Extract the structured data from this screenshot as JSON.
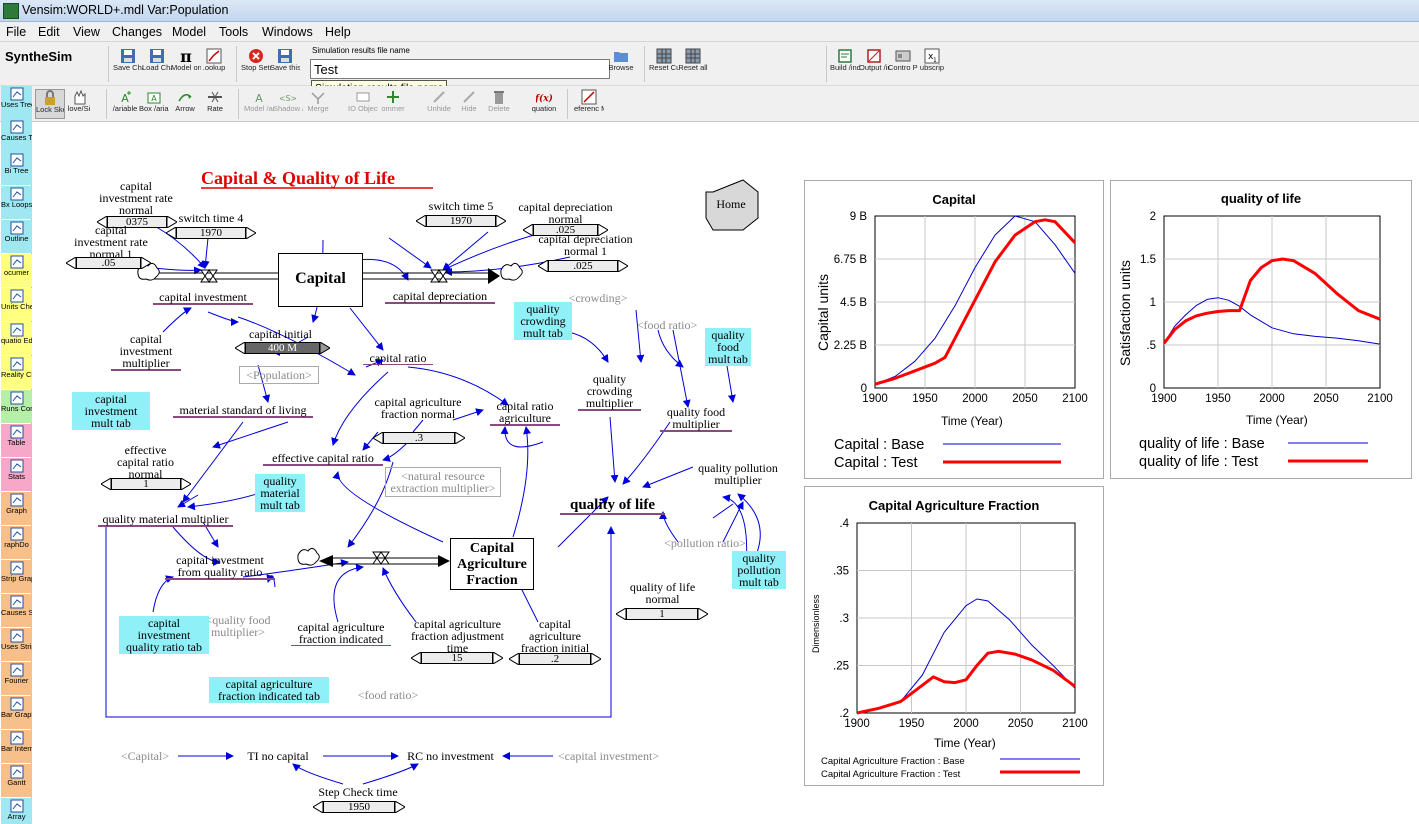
{
  "window": {
    "title": "Vensim:WORLD+.mdl Var:Population"
  },
  "menu": [
    "File",
    "Edit",
    "View",
    "Changes",
    "Model",
    "Tools",
    "Windows",
    "Help"
  ],
  "toolbar1": {
    "synthesim": "SyntheSim",
    "results_label": "Simulation results file name",
    "results_value": "Test",
    "tooltip": "Simulation results file name",
    "buttons": [
      {
        "label": "Save Change"
      },
      {
        "label": "Load Change"
      },
      {
        "label": "Model onstan"
      },
      {
        "label": ".ookup"
      },
      {
        "label": "Stop Setup"
      },
      {
        "label": "Save this"
      },
      {
        "label": "Browse"
      },
      {
        "label": "Reset Current"
      },
      {
        "label": "Reset all"
      },
      {
        "label": "Build /indow"
      },
      {
        "label": "Output /indow"
      },
      {
        "label": "Contro Panel"
      },
      {
        "label": "ubscrip"
      }
    ]
  },
  "toolbar2": {
    "buttons": [
      {
        "label": "Lock Sketch"
      },
      {
        "label": "love/Si"
      },
      {
        "label": "/ariable"
      },
      {
        "label": "Box /ariabl"
      },
      {
        "label": "Arrow"
      },
      {
        "label": "Rate"
      },
      {
        "label": "Model /ariabl"
      },
      {
        "label": "Shadow /ariabl"
      },
      {
        "label": "Merge"
      },
      {
        "label": "IO Object"
      },
      {
        "label": "ommer"
      },
      {
        "label": "Unhide"
      },
      {
        "label": "Hide"
      },
      {
        "label": "Delete"
      },
      {
        "label": "quation"
      },
      {
        "label": "eferenc Mode"
      }
    ]
  },
  "palette": [
    {
      "label": "Uses Tree",
      "color": "#9fe8f2"
    },
    {
      "label": "Causes Tree",
      "color": "#9fe8f2"
    },
    {
      "label": "Bi Tree",
      "color": "#9fe8f2"
    },
    {
      "label": "Bx Loops",
      "color": "#9fe8f2"
    },
    {
      "label": "Outline",
      "color": "#9fe8f2"
    },
    {
      "label": "ocumer",
      "color": "#ffff80"
    },
    {
      "label": "Units Check",
      "color": "#ffff80"
    },
    {
      "label": "quatio Editor",
      "color": "#ffff80"
    },
    {
      "label": "Reality Check",
      "color": "#ffff80"
    },
    {
      "label": "Runs Compar",
      "color": "#b6f0a8"
    },
    {
      "label": "Table",
      "color": "#f7a8c8"
    },
    {
      "label": "Stats",
      "color": "#f7a8c8"
    },
    {
      "label": "Graph",
      "color": "#f7c08a"
    },
    {
      "label": "raphDo",
      "color": "#f7c08a"
    },
    {
      "label": "Strip Graph",
      "color": "#f7c08a"
    },
    {
      "label": "Causes Strip",
      "color": "#f7c08a"
    },
    {
      "label": "Uses Strip",
      "color": "#f7c08a"
    },
    {
      "label": "Fourier",
      "color": "#f7c08a"
    },
    {
      "label": "Bar Graph",
      "color": "#f7c08a"
    },
    {
      "label": "Bar Intern",
      "color": "#f7c08a"
    },
    {
      "label": "Gantt",
      "color": "#f7c08a"
    },
    {
      "label": "Array",
      "color": "#9fe8f2"
    }
  ],
  "diagram": {
    "title": "Capital & Quality of Life",
    "home": "Home",
    "stocks": {
      "capital": "Capital",
      "caf": "Capital Agriculture Fraction"
    },
    "sliders": {
      "cirn": "0375",
      "switch4": "1970",
      "cirn1": ".05",
      "switch5": "1970",
      "cdn": ".025",
      "cdn1": ".025",
      "capinit": "400 M",
      "cafn": ".3",
      "ecrn": "1",
      "cafat": "15",
      "cafi": ".2",
      "qoln": "1",
      "step": "1950"
    },
    "labels": {
      "cirn": "capital investment rate normal",
      "switch4": "switch time 4",
      "cirn1": "capital investment rate normal 1",
      "switch5": "switch time 5",
      "cdn": "capital depreciation normal",
      "cdn1": "capital depreciation normal 1",
      "ci": "capital investment",
      "cd": "capital depreciation",
      "cim": "capital investment multiplier",
      "capinit": "capital initial",
      "pop": "<Population>",
      "cr": "capital ratio",
      "craf": "capital ratio agriculture",
      "cafn": "capital agriculture fraction normal",
      "msol": "material standard of living",
      "ecr": "effective capital ratio",
      "nrem": "<natural resource extraction multiplier>",
      "ecrn": "effective capital ratio normal",
      "qmm": "quality material multiplier",
      "ciqr": "capital investment from quality ratio",
      "qfm_s": "<quality food multiplier>",
      "cafind": "capital agriculture fraction indicated",
      "food_s2": "<food ratio>",
      "cafat": "capital agriculture fraction adjustment time",
      "cafi": "capital agriculture fraction initial",
      "crowd": "<crowding>",
      "qcm": "quality crowding multiplier",
      "food_s": "<food ratio>",
      "qfm": "quality food multiplier",
      "qpm": "quality pollution multiplier",
      "qol": "quality of life",
      "pollr": "<pollution ratio>",
      "qoln": "quality of life normal",
      "cap_s": "<Capital>",
      "tinc": "TI no capital",
      "rcni": "RC no investment",
      "ci_s": "<capital investment>",
      "step": "Step Check time"
    },
    "tables": {
      "cimt": "capital investment mult tab",
      "qmmt": "quality material mult tab",
      "ciqrt": "capital investment quality ratio tab",
      "cafit": "capital agriculture fraction indicated tab",
      "qcmt": "quality crowding mult tab",
      "qfmt": "quality food mult tab",
      "qpmt": "quality pollution mult tab"
    }
  },
  "chart_data": [
    {
      "type": "line",
      "title": "Capital",
      "ylabel": "Capital units",
      "xlabel": "Time (Year)",
      "xlim": [
        1900,
        2100
      ],
      "ylim": [
        0,
        9000000000
      ],
      "xticks": [
        "1900",
        "1950",
        "2000",
        "2050",
        "2100"
      ],
      "yticks": [
        "0",
        "2.25 B",
        "4.5 B",
        "6.75 B",
        "9 B"
      ],
      "series": [
        {
          "name": "Capital : Base",
          "color": "#0000cc",
          "width": 1,
          "x": [
            1900,
            1920,
            1940,
            1960,
            1980,
            2000,
            2020,
            2040,
            2060,
            2080,
            2100
          ],
          "y": [
            200000000.0,
            600000000.0,
            1400000000.0,
            2600000000.0,
            4300000000.0,
            6300000000.0,
            8000000000.0,
            9000000000.0,
            8700000000.0,
            7500000000.0,
            6000000000.0
          ]
        },
        {
          "name": "Capital : Test",
          "color": "#ff0000",
          "width": 3,
          "x": [
            1900,
            1920,
            1940,
            1960,
            1970,
            1980,
            2000,
            2020,
            2040,
            2060,
            2070,
            2080,
            2100
          ],
          "y": [
            200000000.0,
            500000000.0,
            900000000.0,
            1300000000.0,
            1600000000.0,
            2600000000.0,
            4600000000.0,
            6600000000.0,
            8000000000.0,
            8700000000.0,
            8800000000.0,
            8700000000.0,
            7600000000.0
          ]
        }
      ]
    },
    {
      "type": "line",
      "title": "quality of life",
      "ylabel": "Satisfaction units",
      "xlabel": "Time (Year)",
      "xlim": [
        1900,
        2100
      ],
      "ylim": [
        0,
        2
      ],
      "xticks": [
        "1900",
        "1950",
        "2000",
        "2050",
        "2100"
      ],
      "yticks": [
        "0",
        ".5",
        "1",
        "1.5",
        "2"
      ],
      "series": [
        {
          "name": "quality of life : Base",
          "color": "#0000cc",
          "width": 1,
          "x": [
            1900,
            1910,
            1920,
            1930,
            1940,
            1950,
            1960,
            1970,
            1980,
            2000,
            2020,
            2040,
            2060,
            2080,
            2100
          ],
          "y": [
            0.52,
            0.72,
            0.85,
            0.96,
            1.03,
            1.05,
            1.02,
            0.95,
            0.85,
            0.7,
            0.63,
            0.6,
            0.58,
            0.55,
            0.51
          ]
        },
        {
          "name": "quality of life : Test",
          "color": "#ff0000",
          "width": 3,
          "x": [
            1900,
            1910,
            1920,
            1930,
            1940,
            1950,
            1960,
            1970,
            1980,
            1990,
            2000,
            2010,
            2020,
            2040,
            2060,
            2080,
            2100
          ],
          "y": [
            0.52,
            0.68,
            0.78,
            0.84,
            0.87,
            0.89,
            0.9,
            0.9,
            1.25,
            1.4,
            1.48,
            1.5,
            1.48,
            1.33,
            1.1,
            0.9,
            0.8
          ]
        }
      ]
    },
    {
      "type": "line",
      "title": "Capital Agriculture Fraction",
      "ylabel": "Dimensionless",
      "xlabel": "Time (Year)",
      "xlim": [
        1900,
        2100
      ],
      "ylim": [
        0.2,
        0.4
      ],
      "xticks": [
        "1900",
        "1950",
        "2000",
        "2050",
        "2100"
      ],
      "yticks": [
        ".2",
        ".25",
        ".3",
        ".35",
        ".4"
      ],
      "series": [
        {
          "name": "Capital Agriculture Fraction : Base",
          "color": "#0000cc",
          "width": 1,
          "x": [
            1900,
            1920,
            1940,
            1960,
            1980,
            2000,
            2010,
            2020,
            2040,
            2060,
            2080,
            2100
          ],
          "y": [
            0.2,
            0.205,
            0.212,
            0.24,
            0.285,
            0.313,
            0.32,
            0.318,
            0.298,
            0.272,
            0.25,
            0.226
          ]
        },
        {
          "name": "Capital Agriculture Fraction : Test",
          "color": "#ff0000",
          "width": 3,
          "x": [
            1900,
            1920,
            1940,
            1955,
            1970,
            1980,
            1990,
            2000,
            2010,
            2020,
            2030,
            2045,
            2060,
            2080,
            2100
          ],
          "y": [
            0.2,
            0.205,
            0.212,
            0.225,
            0.238,
            0.233,
            0.232,
            0.235,
            0.25,
            0.263,
            0.265,
            0.262,
            0.256,
            0.245,
            0.228
          ]
        }
      ]
    }
  ]
}
